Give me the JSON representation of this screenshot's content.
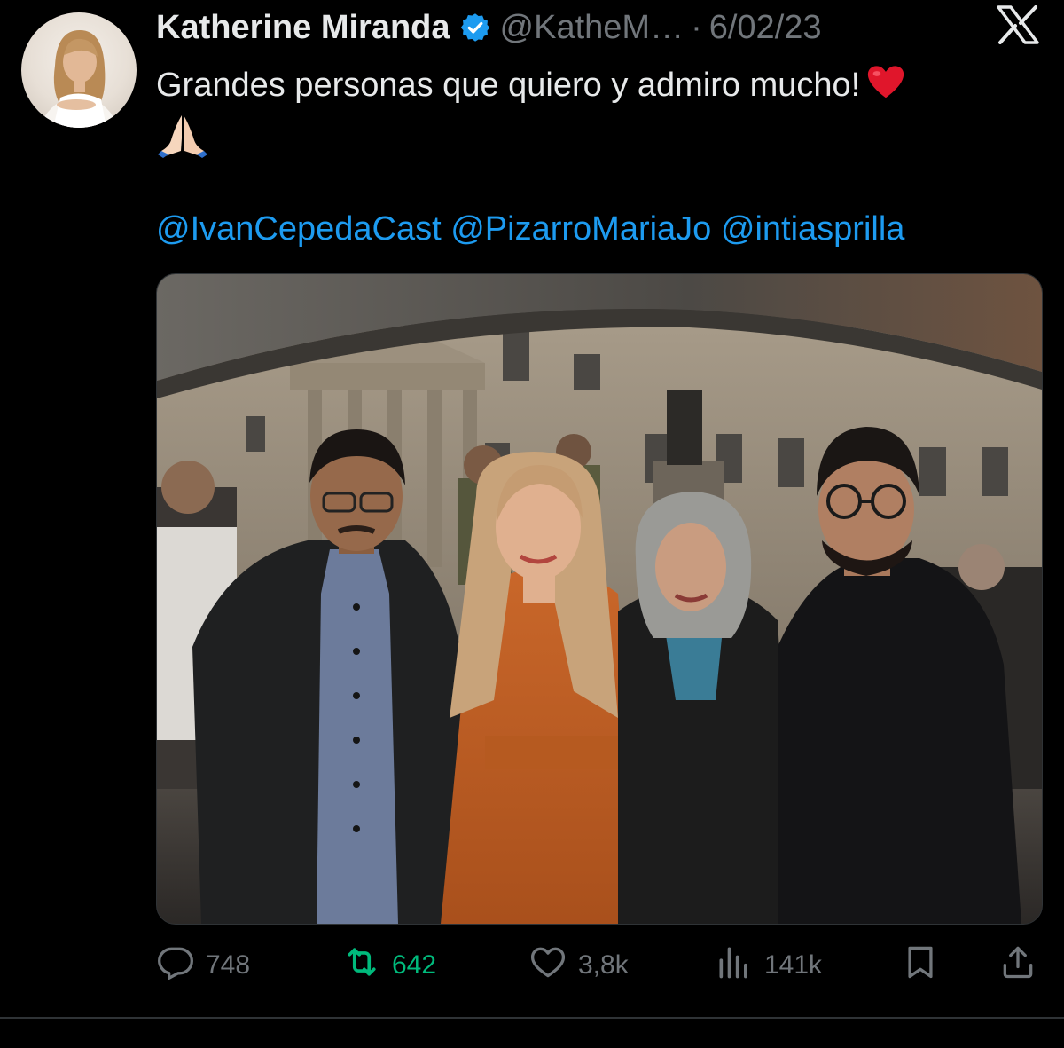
{
  "tweet": {
    "author_name": "Katherine Miranda",
    "handle": "@KatheM…",
    "separator": "·",
    "date": "6/02/23",
    "text_line1": "Grandes personas que quiero y admiro mucho!",
    "mentions": [
      "@IvanCepedaCast",
      "@PizarroMariaJo",
      "@intiasprilla"
    ],
    "emojis": [
      "heart-emoji",
      "folded-hands-emoji"
    ]
  },
  "actions": {
    "replies": "748",
    "retweets": "642",
    "likes": "3,8k",
    "views": "141k"
  },
  "icons": [
    "verified-badge-icon",
    "x-logo-icon",
    "reply-icon",
    "retweet-icon",
    "like-icon",
    "views-icon",
    "bookmark-icon",
    "share-icon"
  ],
  "colors": {
    "background": "#000000",
    "text": "#e7e9ea",
    "muted": "#71767b",
    "link": "#1d9bf0",
    "retweet_active": "#00ba7c",
    "verified": "#1d9bf0"
  }
}
